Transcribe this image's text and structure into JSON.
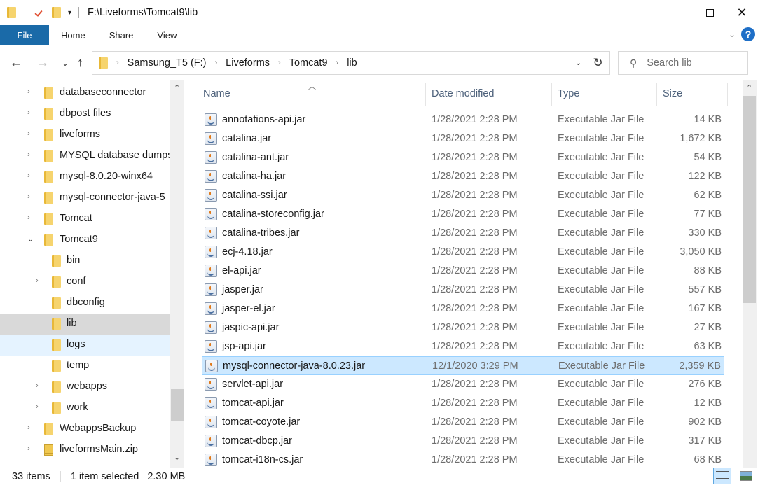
{
  "window": {
    "title": "F:\\Liveforms\\Tomcat9\\lib",
    "minimize_icon": "minimize-icon",
    "maximize_icon": "maximize-icon",
    "close_icon": "close-icon",
    "close_glyph": "✕"
  },
  "ribbon": {
    "tabs": [
      "File",
      "Home",
      "Share",
      "View"
    ],
    "help_glyph": "?",
    "expand_glyph": "⌄"
  },
  "nav": {
    "back_glyph": "←",
    "forward_glyph": "→",
    "recent_glyph": "⌄",
    "up_glyph": "↑"
  },
  "address": {
    "crumbs": [
      "Samsung_T5 (F:)",
      "Liveforms",
      "Tomcat9",
      "lib"
    ],
    "separator": "›",
    "dropdown_glyph": "⌄",
    "refresh_glyph": "↻"
  },
  "search": {
    "placeholder": "Search lib",
    "icon_glyph": "⚲"
  },
  "tree": {
    "items": [
      {
        "label": "databaseconnector",
        "level": 1,
        "expander": "›",
        "state": ""
      },
      {
        "label": "dbpost files",
        "level": 1,
        "expander": "›",
        "state": ""
      },
      {
        "label": "liveforms",
        "level": 1,
        "expander": "›",
        "state": ""
      },
      {
        "label": "MYSQL database dumps",
        "level": 1,
        "expander": "›",
        "state": ""
      },
      {
        "label": "mysql-8.0.20-winx64",
        "level": 1,
        "expander": "›",
        "state": ""
      },
      {
        "label": "mysql-connector-java-5",
        "level": 1,
        "expander": "›",
        "state": ""
      },
      {
        "label": "Tomcat",
        "level": 1,
        "expander": "›",
        "state": ""
      },
      {
        "label": "Tomcat9",
        "level": 1,
        "expander": "⌄",
        "state": "expanded"
      },
      {
        "label": "bin",
        "level": 2,
        "expander": "",
        "state": ""
      },
      {
        "label": "conf",
        "level": 2,
        "expander": "›",
        "state": ""
      },
      {
        "label": "dbconfig",
        "level": 2,
        "expander": "",
        "state": ""
      },
      {
        "label": "lib",
        "level": 2,
        "expander": "",
        "state": "selected"
      },
      {
        "label": "logs",
        "level": 2,
        "expander": "",
        "state": "hover"
      },
      {
        "label": "temp",
        "level": 2,
        "expander": "",
        "state": ""
      },
      {
        "label": "webapps",
        "level": 2,
        "expander": "›",
        "state": ""
      },
      {
        "label": "work",
        "level": 2,
        "expander": "›",
        "state": ""
      },
      {
        "label": "WebappsBackup",
        "level": 1,
        "expander": "›",
        "state": ""
      },
      {
        "label": "liveformsMain.zip",
        "level": 1,
        "expander": "›",
        "state": "",
        "kind": "zip"
      }
    ],
    "scroll_up_glyph": "⌃",
    "scroll_down_glyph": "⌄"
  },
  "list": {
    "columns": {
      "name": "Name",
      "date": "Date modified",
      "type": "Type",
      "size": "Size"
    },
    "sort_glyph": "︿",
    "files": [
      {
        "name": "annotations-api.jar",
        "date": "1/28/2021 2:28 PM",
        "type": "Executable Jar File",
        "size": "14 KB"
      },
      {
        "name": "catalina.jar",
        "date": "1/28/2021 2:28 PM",
        "type": "Executable Jar File",
        "size": "1,672 KB"
      },
      {
        "name": "catalina-ant.jar",
        "date": "1/28/2021 2:28 PM",
        "type": "Executable Jar File",
        "size": "54 KB"
      },
      {
        "name": "catalina-ha.jar",
        "date": "1/28/2021 2:28 PM",
        "type": "Executable Jar File",
        "size": "122 KB"
      },
      {
        "name": "catalina-ssi.jar",
        "date": "1/28/2021 2:28 PM",
        "type": "Executable Jar File",
        "size": "62 KB"
      },
      {
        "name": "catalina-storeconfig.jar",
        "date": "1/28/2021 2:28 PM",
        "type": "Executable Jar File",
        "size": "77 KB"
      },
      {
        "name": "catalina-tribes.jar",
        "date": "1/28/2021 2:28 PM",
        "type": "Executable Jar File",
        "size": "330 KB"
      },
      {
        "name": "ecj-4.18.jar",
        "date": "1/28/2021 2:28 PM",
        "type": "Executable Jar File",
        "size": "3,050 KB"
      },
      {
        "name": "el-api.jar",
        "date": "1/28/2021 2:28 PM",
        "type": "Executable Jar File",
        "size": "88 KB"
      },
      {
        "name": "jasper.jar",
        "date": "1/28/2021 2:28 PM",
        "type": "Executable Jar File",
        "size": "557 KB"
      },
      {
        "name": "jasper-el.jar",
        "date": "1/28/2021 2:28 PM",
        "type": "Executable Jar File",
        "size": "167 KB"
      },
      {
        "name": "jaspic-api.jar",
        "date": "1/28/2021 2:28 PM",
        "type": "Executable Jar File",
        "size": "27 KB"
      },
      {
        "name": "jsp-api.jar",
        "date": "1/28/2021 2:28 PM",
        "type": "Executable Jar File",
        "size": "63 KB"
      },
      {
        "name": "mysql-connector-java-8.0.23.jar",
        "date": "12/1/2020 3:29 PM",
        "type": "Executable Jar File",
        "size": "2,359 KB",
        "selected": true
      },
      {
        "name": "servlet-api.jar",
        "date": "1/28/2021 2:28 PM",
        "type": "Executable Jar File",
        "size": "276 KB"
      },
      {
        "name": "tomcat-api.jar",
        "date": "1/28/2021 2:28 PM",
        "type": "Executable Jar File",
        "size": "12 KB"
      },
      {
        "name": "tomcat-coyote.jar",
        "date": "1/28/2021 2:28 PM",
        "type": "Executable Jar File",
        "size": "902 KB"
      },
      {
        "name": "tomcat-dbcp.jar",
        "date": "1/28/2021 2:28 PM",
        "type": "Executable Jar File",
        "size": "317 KB"
      },
      {
        "name": "tomcat-i18n-cs.jar",
        "date": "1/28/2021 2:28 PM",
        "type": "Executable Jar File",
        "size": "68 KB"
      }
    ]
  },
  "status": {
    "item_count": "33 items",
    "selection": "1 item selected",
    "selection_size": "2.30 MB"
  },
  "colors": {
    "file_tab": "#1a6aa8",
    "selection": "#cce8ff",
    "selection_border": "#99d1ff",
    "tree_selected": "#d9d9d9",
    "tree_hover": "#e5f3ff",
    "header_text": "#4c607a"
  }
}
